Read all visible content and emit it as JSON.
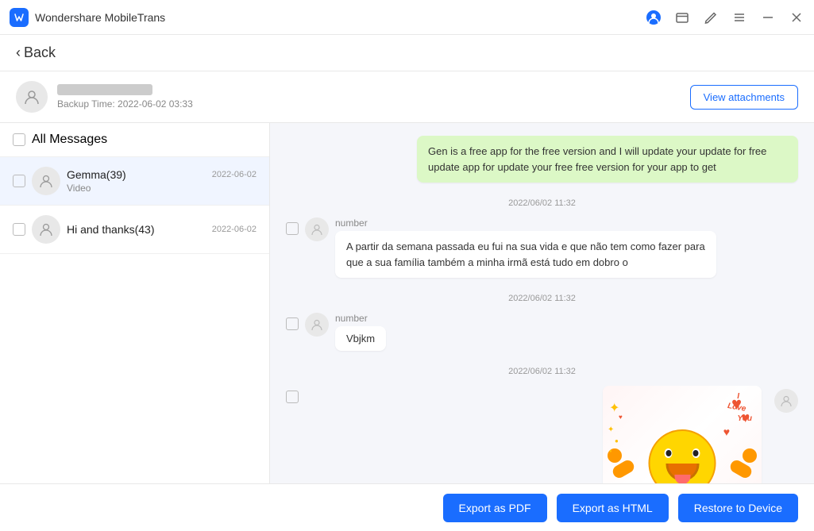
{
  "app": {
    "title": "Wondershare MobileTrans",
    "logo_letter": "W"
  },
  "titlebar": {
    "controls": [
      "account-icon",
      "window-icon",
      "edit-icon",
      "menu-icon",
      "minimize-icon",
      "close-icon"
    ]
  },
  "back_header": {
    "label": "Back"
  },
  "backup_info": {
    "backup_time_label": "Backup Time: 2022-06-02 03:33",
    "view_attachments_label": "View attachments"
  },
  "left_panel": {
    "all_messages_label": "All Messages",
    "conversations": [
      {
        "name": "Gemma(39)",
        "date": "2022-06-02",
        "preview": "Video",
        "active": true
      },
      {
        "name": "Hi and thanks(43)",
        "date": "2022-06-02",
        "preview": "",
        "active": false
      }
    ]
  },
  "messages": [
    {
      "type": "sent",
      "text": "Gen is a free app for the free version and I will update your update for free update app for update your free free version for your app to get",
      "timestamp": null
    },
    {
      "type": "timestamp",
      "value": "2022/06/02 11:32"
    },
    {
      "type": "received",
      "sender": "number",
      "text": "A partir da semana passada eu fui na sua vida e que não tem como fazer para que a sua família também a minha irmã está tudo em dobro o"
    },
    {
      "type": "timestamp",
      "value": "2022/06/02 11:32"
    },
    {
      "type": "received",
      "sender": "number",
      "text": "Vbjkm"
    },
    {
      "type": "timestamp",
      "value": "2022/06/02 11:32"
    },
    {
      "type": "image",
      "sender": null
    }
  ],
  "bottom_bar": {
    "export_pdf_label": "Export as PDF",
    "export_html_label": "Export as HTML",
    "restore_label": "Restore to Device"
  }
}
